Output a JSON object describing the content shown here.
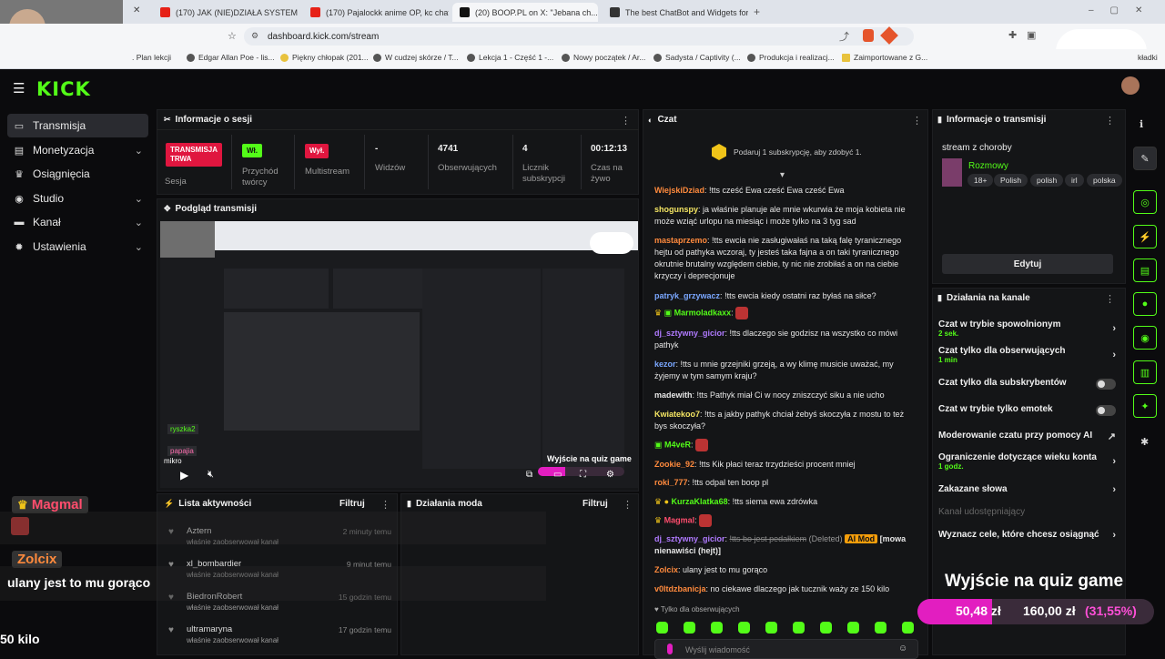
{
  "browser": {
    "tabs": [
      {
        "label": "(170) JAK (NIE)DZIAŁA SYSTEM KAUC",
        "color": "#e62117"
      },
      {
        "label": "(170) Pajalockk anime OP, kc chat - Y",
        "color": "#e62117"
      },
      {
        "label": "(20) BOOP.PL on X: \"Jebana ch...",
        "color": "#111111"
      },
      {
        "label": "The best ChatBot and Widgets for K",
        "color": "#333333"
      }
    ],
    "url": "dashboard.kick.com/stream",
    "bookmarks": [
      ". Plan lekcji",
      "Edgar Allan Poe - lis...",
      "Piękny chłopak (201...",
      "W cudzej skórze / T...",
      "Lekcja 1 - Część 1 -...",
      "Nowy początek / Ar...",
      "Sadysta / Captivity (...",
      "Produkcja i realizacj...",
      "Zaimportowane z G..."
    ],
    "bookmarks_other": "kładki"
  },
  "brand": {
    "logo": "KICK",
    "accent": "#53fc18",
    "live_red": "#e0163f"
  },
  "sidebar": {
    "items": [
      {
        "label": "Transmisja",
        "icon": "broadcast-icon",
        "active": true
      },
      {
        "label": "Monetyzacja",
        "icon": "wallet-icon",
        "expand": true
      },
      {
        "label": "Osiągnięcia",
        "icon": "trophy-icon"
      },
      {
        "label": "Studio",
        "icon": "studio-icon",
        "expand": true
      },
      {
        "label": "Kanał",
        "icon": "channel-icon",
        "expand": true
      },
      {
        "label": "Ustawienia",
        "icon": "gear-icon",
        "expand": true
      }
    ]
  },
  "session": {
    "title": "Informacje o sesji",
    "stats": [
      {
        "value": "TRANSMISJA TRWA",
        "label": "Sesja"
      },
      {
        "value": "Wł.",
        "label": "Przychód twórcy"
      },
      {
        "value": "Wył.",
        "label": "Multistream"
      },
      {
        "value": "-",
        "label": "Widzów"
      },
      {
        "value": "4741",
        "label": "Obserwujących"
      },
      {
        "value": "4",
        "label": "Licznik subskrypcji"
      },
      {
        "value": "00:12:13",
        "label": "Czas na żywo"
      }
    ]
  },
  "preview": {
    "title": "Podgląd transmisji",
    "overlay_title": "Wyjście na quiz game",
    "goal_current": "50,48 zł",
    "goal_target": "160,00 zł",
    "goal_percent": "(31,55%)",
    "progress": 0.3155
  },
  "activity": {
    "title": "Lista aktywności",
    "filter": "Filtruj",
    "items": [
      {
        "name": "Aztern",
        "desc": "właśnie zaobserwował kanał",
        "time": "2 minuty temu"
      },
      {
        "name": "xl_bombardier",
        "desc": "właśnie zaobserwował kanał",
        "time": "9 minut temu"
      },
      {
        "name": "BiedronRobert",
        "desc": "właśnie zaobserwował kanał",
        "time": "15 godzin temu"
      },
      {
        "name": "ultramaryna",
        "desc": "właśnie zaobserwował kanał",
        "time": "17 godzin temu"
      }
    ]
  },
  "mod": {
    "title": "Działania moda",
    "filter": "Filtruj"
  },
  "chat": {
    "title": "Czat",
    "pinned": "Podaruj 1 subskrypcję, aby zdobyć 1.",
    "messages": [
      {
        "user": "WiejskiDziad",
        "color": "#ff8a3d",
        "text": "!tts cześć Ewa cześć Ewa cześć Ewa"
      },
      {
        "user": "shogunspy",
        "color": "#f5e663",
        "text": "ja właśnie planuje ale mnie wkurwia że moja kobieta nie może wziąć urlopu na miesiąc i może tylko na 3 tyg sad"
      },
      {
        "user": "mastaprzemo",
        "color": "#ff8a3d",
        "text": "!tts ewcia nie zasługiwałaś na taką falę tyranicznego hejtu od pathyka wczoraj, ty jesteś taka fajna a on taki tyranicznego okrutnie brutalny względem ciebie, ty nic nie zrobiłaś a on na ciebie krzyczy i deprecjonuje"
      },
      {
        "user": "patryk_grzywacz",
        "color": "#7aa7ff",
        "text": "!tts ewcia kiedy ostatni raz byłaś na siłce?"
      },
      {
        "user": "Marmoladkaxx",
        "color": "#53fc18",
        "text": ""
      },
      {
        "user": "dj_sztywny_gicior",
        "color": "#b07aff",
        "text": "!tts dlaczego sie godzisz na wszystko co mówi pathyk"
      },
      {
        "user": "kezor",
        "color": "#7aa7ff",
        "text": "!tts u mnie grzejniki grzeją, a wy klimę musicie uważać, my żyjemy w tym samym kraju?"
      },
      {
        "user": "madewith",
        "color": "#e6e6e6",
        "text": "!tts Pathyk miał Ci w nocy zniszczyć siku a nie ucho"
      },
      {
        "user": "Kwiatekoo7",
        "color": "#f5e663",
        "text": "!tts a jakby pathyk chciał żebyś skoczyła z mostu to też bys skoczyła?"
      },
      {
        "user": "M4veR",
        "color": "#53fc18",
        "text": ""
      },
      {
        "user": "Zookie_92",
        "color": "#ff8a3d",
        "text": "!tts Kik płaci teraz trzydzieści procent mniej"
      },
      {
        "user": "roki_777",
        "color": "#ff8a3d",
        "text": "!tts odpal ten boop pl"
      },
      {
        "user": "KurzaKlatka68",
        "color": "#53fc18",
        "text": "!tts siema ewa zdrówka"
      },
      {
        "user": "Magmal",
        "color": "#ff4d6d",
        "text": ""
      },
      {
        "user": "dj_sztywny_gicior",
        "color": "#b07aff",
        "text": "!tts bo jest pedałkiem",
        "deleted": "(Deleted)",
        "mod": "AI Mod",
        "reason": "[mowa nienawiści (hejt)]"
      },
      {
        "user": "Zolcix",
        "color": "#ff8a3d",
        "text": "ulany jest to mu gorąco"
      },
      {
        "user": "v0ltdzbanicja",
        "color": "#ff8a3d",
        "text": "no ciekawe dlaczego jak tucznik waży ze 150 kilo"
      }
    ],
    "followers_only": "Tylko dla obserwujących",
    "input_placeholder": "Wyślij wiadomość"
  },
  "stream_info": {
    "title": "Informacje o transmisji",
    "stream_title": "stream z choroby",
    "category": "Rozmowy",
    "tags": [
      "18+",
      "Polish",
      "polish",
      "irl",
      "polska"
    ],
    "edit": "Edytuj"
  },
  "channel_actions": {
    "title": "Działania na kanale",
    "items": [
      {
        "label": "Czat w trybie spowolnionym",
        "sub": "2 sek.",
        "control": "arrow"
      },
      {
        "label": "Czat tylko dla obserwujących",
        "sub": "1 min",
        "control": "arrow"
      },
      {
        "label": "Czat tylko dla subskrybentów",
        "sub": "",
        "control": "toggle"
      },
      {
        "label": "Czat w trybie tylko emotek",
        "sub": "",
        "control": "toggle"
      },
      {
        "label": "Moderowanie czatu przy pomocy AI",
        "sub": "",
        "control": "external"
      },
      {
        "label": "Ograniczenie dotyczące wieku konta",
        "sub": "1 godz.",
        "control": "arrow"
      },
      {
        "label": "Zakazane słowa",
        "sub": "",
        "control": "arrow"
      },
      {
        "label": "Kanał udostępniający",
        "sub": "",
        "control": "none"
      },
      {
        "label": "Wyznacz cele, które chcesz osiągnąć",
        "sub": "",
        "control": "arrow"
      }
    ]
  },
  "overlay": {
    "chat_user1": "Magmal",
    "chat_user2": "Zolcix",
    "chat_text": "ulany jest to mu gorąco",
    "chat_text2": "50 kilo",
    "goal_title": "Wyjście na quiz game",
    "goal_current": "50,48 zł",
    "goal_target": "160,00 zł",
    "goal_percent": "(31,55%)",
    "preview_user": "ryszka2",
    "preview_user2": "papajia",
    "preview_text": "mikro"
  }
}
